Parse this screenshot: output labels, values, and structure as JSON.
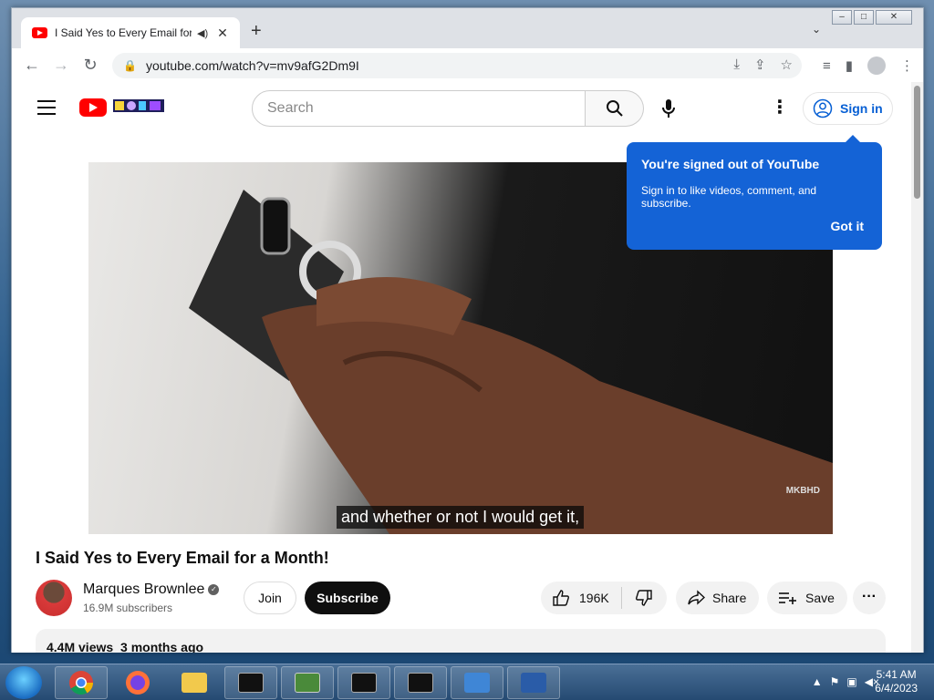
{
  "browser": {
    "tab_title": "I Said Yes to Every Email for a Month!",
    "tab_audio_icon": "speaker-icon",
    "url": "youtube.com/watch?v=mv9afG2Dm9I",
    "window_controls": [
      "minimize",
      "maximize",
      "close"
    ]
  },
  "youtube": {
    "search_placeholder": "Search",
    "sign_in_label": "Sign in",
    "tooltip": {
      "title": "You're signed out of YouTube",
      "body": "Sign in to like videos, comment, and subscribe.",
      "button": "Got it"
    },
    "video": {
      "caption": "and whether or not I would get it,",
      "watermark": "MKBHD"
    },
    "title": "I Said Yes to Every Email for a Month!",
    "channel": {
      "name": "Marques Brownlee",
      "subscribers": "16.9M subscribers",
      "join_label": "Join",
      "subscribe_label": "Subscribe"
    },
    "actions": {
      "likes": "196K",
      "share_label": "Share",
      "save_label": "Save"
    },
    "description": {
      "views": "4.4M views",
      "age": "3 months ago"
    }
  },
  "taskbar": {
    "time": "5:41 AM",
    "date": "6/4/2023"
  }
}
